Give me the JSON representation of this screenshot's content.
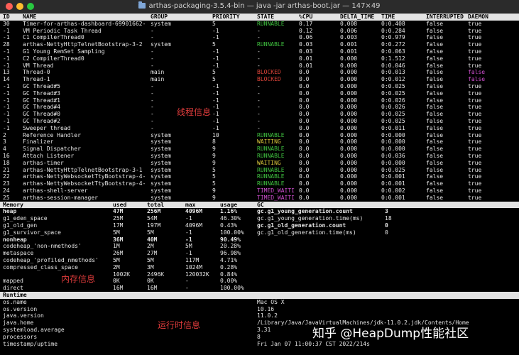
{
  "window": {
    "title": "arthas-packaging-3.5.4-bin — java -jar arthas-boot.jar — 147×49"
  },
  "annotations": {
    "thread": "线程信息",
    "memory": "内存信息",
    "runtime": "运行时信息"
  },
  "watermark": "知乎 @HeapDump性能社区",
  "threads": {
    "headers": [
      "ID",
      "NAME",
      "GROUP",
      "PRIORITY",
      "STATE",
      "%CPU",
      "DELTA_TIME",
      "TIME",
      "INTERRUPTED",
      "DAEMON"
    ],
    "rows": [
      [
        "30",
        "Timer-for-arthas-dashboard-69901662-",
        "system",
        "5",
        "RUNNABLE",
        "0.17",
        "0.008",
        "0:0.408",
        "false",
        "true"
      ],
      [
        "-1",
        "VM Periodic Task Thread",
        "-",
        "-1",
        "-",
        "0.12",
        "0.006",
        "0:0.284",
        "false",
        "true"
      ],
      [
        "-1",
        "C1 CompilerThread0",
        "-",
        "-1",
        "-",
        "0.06",
        "0.003",
        "0:0.979",
        "false",
        "true"
      ],
      [
        "28",
        "arthas-NettyHttpTelnetBootstrap-3-2",
        "system",
        "5",
        "RUNNABLE",
        "0.03",
        "0.001",
        "0:0.272",
        "false",
        "true"
      ],
      [
        "-1",
        "G1 Young RemSet Sampling",
        "-",
        "-1",
        "-",
        "0.03",
        "0.001",
        "0:0.063",
        "false",
        "true"
      ],
      [
        "-1",
        "C2 CompilerThread0",
        "-",
        "-1",
        "-",
        "0.01",
        "0.000",
        "0:1.512",
        "false",
        "true"
      ],
      [
        "-1",
        "VM Thread",
        "-",
        "-1",
        "-",
        "0.01",
        "0.000",
        "0:0.046",
        "false",
        "true"
      ],
      [
        "13",
        "Thread-0",
        "main",
        "5",
        "BLOCKED",
        "0.0",
        "0.000",
        "0:0.013",
        "false",
        "false"
      ],
      [
        "14",
        "Thread-1",
        "main",
        "5",
        "BLOCKED",
        "0.0",
        "0.000",
        "0:0.012",
        "false",
        "false"
      ],
      [
        "-1",
        "GC Thread#5",
        "-",
        "-1",
        "-",
        "0.0",
        "0.000",
        "0:0.025",
        "false",
        "true"
      ],
      [
        "-1",
        "GC Thread#3",
        "-",
        "-1",
        "-",
        "0.0",
        "0.000",
        "0:0.025",
        "false",
        "true"
      ],
      [
        "-1",
        "GC Thread#1",
        "-",
        "-1",
        "-",
        "0.0",
        "0.000",
        "0:0.026",
        "false",
        "true"
      ],
      [
        "-1",
        "GC Thread#4",
        "-",
        "-1",
        "-",
        "0.0",
        "0.000",
        "0:0.026",
        "false",
        "true"
      ],
      [
        "-1",
        "GC Thread#0",
        "-",
        "-1",
        "-",
        "0.0",
        "0.000",
        "0:0.025",
        "false",
        "true"
      ],
      [
        "-1",
        "GC Thread#2",
        "-",
        "-1",
        "-",
        "0.0",
        "0.000",
        "0:0.025",
        "false",
        "true"
      ],
      [
        "-1",
        "Sweeper thread",
        "-",
        "-1",
        "-",
        "0.0",
        "0.000",
        "0:0.011",
        "false",
        "true"
      ],
      [
        "2",
        "Reference Handler",
        "system",
        "10",
        "RUNNABLE",
        "0.0",
        "0.000",
        "0:0.000",
        "false",
        "true"
      ],
      [
        "3",
        "Finalizer",
        "system",
        "8",
        "WAITING",
        "0.0",
        "0.000",
        "0:0.000",
        "false",
        "true"
      ],
      [
        "4",
        "Signal Dispatcher",
        "system",
        "9",
        "RUNNABLE",
        "0.0",
        "0.000",
        "0:0.000",
        "false",
        "true"
      ],
      [
        "16",
        "Attach Listener",
        "system",
        "9",
        "RUNNABLE",
        "0.0",
        "0.000",
        "0:0.036",
        "false",
        "true"
      ],
      [
        "18",
        "arthas-timer",
        "system",
        "9",
        "WAITING",
        "0.0",
        "0.000",
        "0:0.000",
        "false",
        "true"
      ],
      [
        "21",
        "arthas-NettyHttpTelnetBootstrap-3-1",
        "system",
        "5",
        "RUNNABLE",
        "0.0",
        "0.000",
        "0:0.025",
        "false",
        "true"
      ],
      [
        "22",
        "arthas-NettyWebsocketTtyBootstrap-4-",
        "system",
        "5",
        "RUNNABLE",
        "0.0",
        "0.000",
        "0:0.001",
        "false",
        "true"
      ],
      [
        "23",
        "arthas-NettyWebsocketTtyBootstrap-4-",
        "system",
        "5",
        "RUNNABLE",
        "0.0",
        "0.000",
        "0:0.001",
        "false",
        "true"
      ],
      [
        "24",
        "arthas-shell-server",
        "system",
        "9",
        "TIMED_WAITI",
        "0.0",
        "0.000",
        "0:0.002",
        "false",
        "true"
      ],
      [
        "25",
        "arthas-session-manager",
        "system",
        "9",
        "TIMED_WAITI",
        "0.0",
        "0.000",
        "0:0.001",
        "false",
        "true"
      ]
    ]
  },
  "memory": {
    "headers": [
      "Memory",
      "used",
      "total",
      "max",
      "usage"
    ],
    "rows": [
      [
        "heap",
        "47M",
        "256M",
        "4096M",
        "1.16%"
      ],
      [
        "g1_eden_space",
        "25M",
        "54M",
        "-1",
        "46.30%"
      ],
      [
        "g1_old_gen",
        "17M",
        "197M",
        "4096M",
        "0.43%"
      ],
      [
        "g1_survivor_space",
        "5M",
        "5M",
        "-1",
        "100.00%"
      ],
      [
        "nonheap",
        "36M",
        "40M",
        "-1",
        "90.49%"
      ],
      [
        "codeheap_'non-nmethods'",
        "1M",
        "2M",
        "5M",
        "20.28%"
      ],
      [
        "metaspace",
        "26M",
        "27M",
        "-1",
        "96.98%"
      ],
      [
        "codeheap_'profiled_nmethods'",
        "5M",
        "5M",
        "117M",
        "4.71%"
      ],
      [
        "compressed_class_space",
        "2M",
        "3M",
        "1024M",
        "0.28%"
      ],
      [
        "",
        "1002K",
        "2496K",
        "120032K",
        "0.84%"
      ],
      [
        "mapped",
        "0K",
        "0K",
        "-",
        "0.00%"
      ],
      [
        "direct",
        "16M",
        "16M",
        "-",
        "100.00%"
      ]
    ]
  },
  "gc": {
    "header": "GC",
    "rows": [
      [
        "gc.g1_young_generation.count",
        "3"
      ],
      [
        "gc.g1_young_generation.time(ms)",
        "18"
      ],
      [
        "gc.g1_old_generation.count",
        "0"
      ],
      [
        "gc.g1_old_generation.time(ms)",
        "0"
      ]
    ]
  },
  "runtime": {
    "header": "Runtime",
    "rows": [
      [
        "os.name",
        "Mac OS X"
      ],
      [
        "os.version",
        "10.16"
      ],
      [
        "java.version",
        "11.0.2"
      ],
      [
        "java.home",
        "/Library/Java/JavaVirtualMachines/jdk-11.0.2.jdk/Contents/Home"
      ],
      [
        "systemload.average",
        "3.31"
      ],
      [
        "processors",
        "8"
      ],
      [
        "timestamp/uptime",
        "Fri Jan 07 11:00:37 CST 2022/214s"
      ]
    ]
  },
  "colors": {
    "RUNNABLE": "#3fc13f",
    "BLOCKED": "#e0453a",
    "WAITING": "#d7c43a",
    "TIMED_WAITI": "#d24fd2",
    "daemon_false": "#d24fd2",
    "annotation": "#e03c3c"
  }
}
